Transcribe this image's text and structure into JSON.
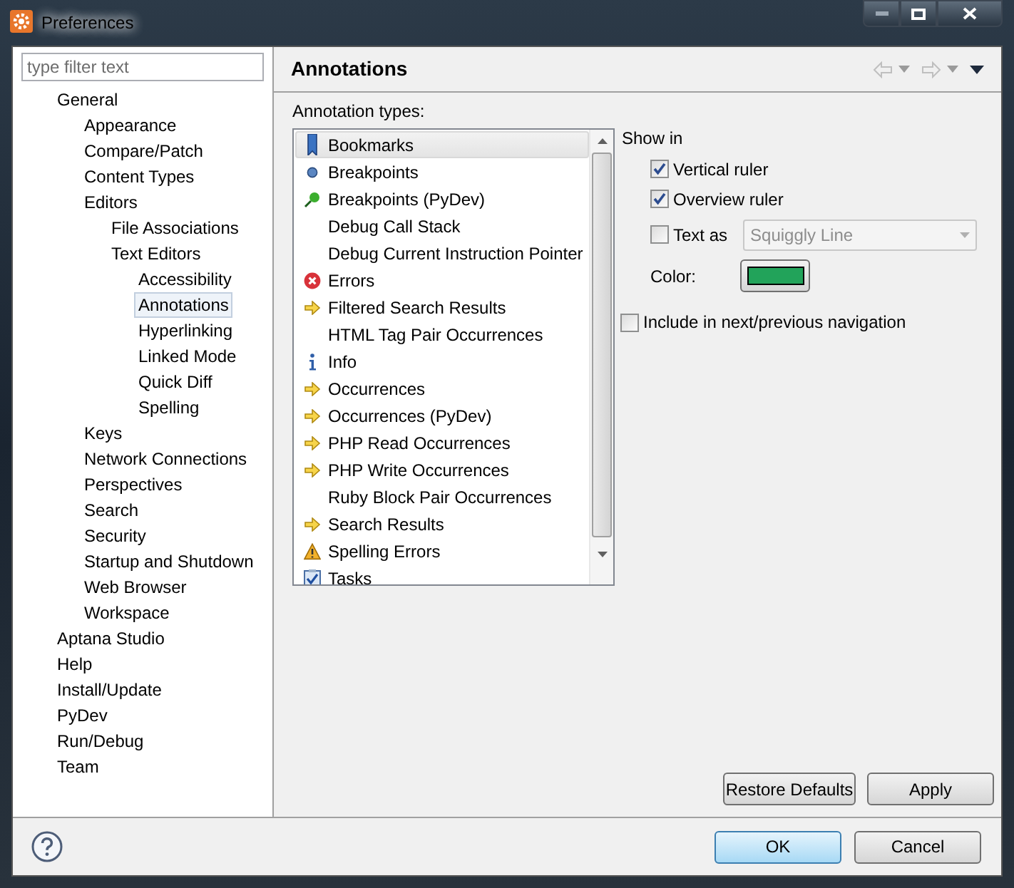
{
  "window": {
    "title": "Preferences"
  },
  "filter": {
    "placeholder": "type filter text"
  },
  "tree": [
    {
      "label": "General",
      "selected": false,
      "children": [
        {
          "label": "Appearance",
          "selected": false
        },
        {
          "label": "Compare/Patch",
          "selected": false
        },
        {
          "label": "Content Types",
          "selected": false
        },
        {
          "label": "Editors",
          "selected": false,
          "children": [
            {
              "label": "File Associations",
              "selected": false
            },
            {
              "label": "Text Editors",
              "selected": false,
              "children": [
                {
                  "label": "Accessibility",
                  "selected": false
                },
                {
                  "label": "Annotations",
                  "selected": true
                },
                {
                  "label": "Hyperlinking",
                  "selected": false
                },
                {
                  "label": "Linked Mode",
                  "selected": false
                },
                {
                  "label": "Quick Diff",
                  "selected": false
                },
                {
                  "label": "Spelling",
                  "selected": false
                }
              ]
            }
          ]
        },
        {
          "label": "Keys",
          "selected": false
        },
        {
          "label": "Network Connections",
          "selected": false
        },
        {
          "label": "Perspectives",
          "selected": false
        },
        {
          "label": "Search",
          "selected": false
        },
        {
          "label": "Security",
          "selected": false
        },
        {
          "label": "Startup and Shutdown",
          "selected": false
        },
        {
          "label": "Web Browser",
          "selected": false
        },
        {
          "label": "Workspace",
          "selected": false
        }
      ]
    },
    {
      "label": "Aptana Studio",
      "selected": false
    },
    {
      "label": "Help",
      "selected": false
    },
    {
      "label": "Install/Update",
      "selected": false
    },
    {
      "label": "PyDev",
      "selected": false
    },
    {
      "label": "Run/Debug",
      "selected": false
    },
    {
      "label": "Team",
      "selected": false
    }
  ],
  "page": {
    "title": "Annotations",
    "list_label": "Annotation types:"
  },
  "annotation_types": [
    {
      "label": "Bookmarks",
      "kind": "bookmark",
      "selected": true
    },
    {
      "label": "Breakpoints",
      "kind": "dot",
      "selected": false
    },
    {
      "label": "Breakpoints (PyDev)",
      "kind": "pin",
      "selected": false
    },
    {
      "label": "Debug Call Stack",
      "kind": "plain",
      "selected": false
    },
    {
      "label": "Debug Current Instruction Pointer",
      "kind": "plain",
      "selected": false
    },
    {
      "label": "Errors",
      "kind": "error",
      "selected": false
    },
    {
      "label": "Filtered Search Results",
      "kind": "arrow",
      "selected": false
    },
    {
      "label": "HTML Tag Pair Occurrences",
      "kind": "plain",
      "selected": false
    },
    {
      "label": "Info",
      "kind": "info",
      "selected": false
    },
    {
      "label": "Occurrences",
      "kind": "arrow",
      "selected": false
    },
    {
      "label": "Occurrences (PyDev)",
      "kind": "arrow",
      "selected": false
    },
    {
      "label": "PHP Read Occurrences",
      "kind": "arrow",
      "selected": false
    },
    {
      "label": "PHP Write Occurrences",
      "kind": "arrow",
      "selected": false
    },
    {
      "label": "Ruby Block Pair Occurrences",
      "kind": "plain",
      "selected": false
    },
    {
      "label": "Search Results",
      "kind": "arrow",
      "selected": false
    },
    {
      "label": "Spelling Errors",
      "kind": "warning",
      "selected": false
    },
    {
      "label": "Tasks",
      "kind": "task",
      "selected": false
    }
  ],
  "show_in": {
    "label": "Show in",
    "options": [
      {
        "label": "Vertical ruler",
        "checked": true
      },
      {
        "label": "Overview ruler",
        "checked": true
      },
      {
        "label": "Text as",
        "checked": false,
        "dropdown": {
          "value": "Squiggly Line",
          "disabled": true
        }
      }
    ]
  },
  "color": {
    "label": "Color:",
    "color": "#22a35a"
  },
  "include_navigation": {
    "label": "Include in next/previous navigation",
    "checked": false
  },
  "page_buttons": [
    "Restore Defaults",
    "Apply"
  ],
  "dialog_buttons": [
    {
      "label": "OK",
      "selected": true
    },
    {
      "label": "Cancel",
      "selected": false
    }
  ]
}
